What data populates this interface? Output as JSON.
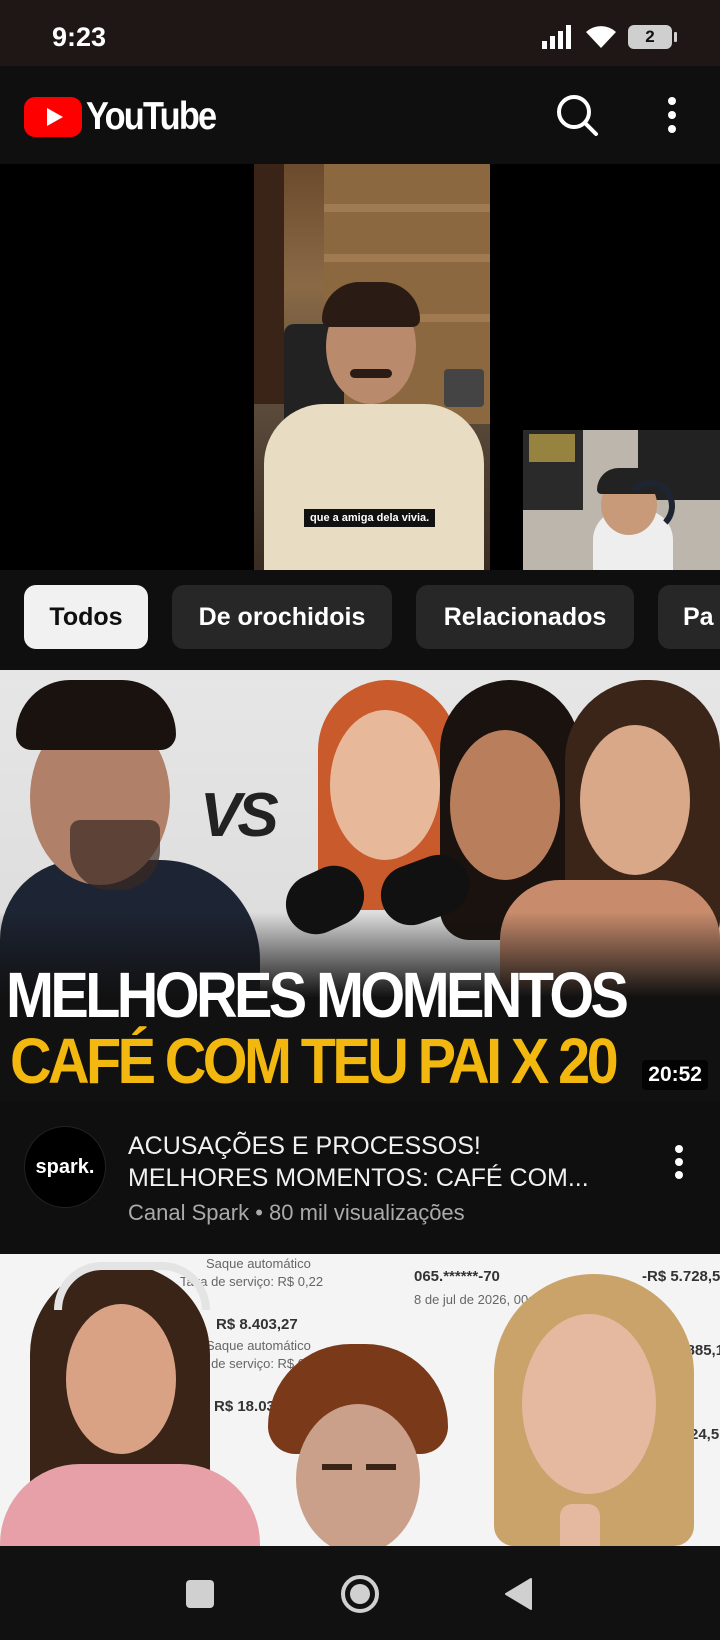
{
  "status": {
    "time": "9:23",
    "battery": "2"
  },
  "app": {
    "logo_text": "YouTube"
  },
  "player": {
    "caption": "que a amiga dela vivia."
  },
  "chips": [
    "Todos",
    "De orochidois",
    "Relacionados",
    "Pa"
  ],
  "video1": {
    "thumb_line1": "MELHORES MOMENTOS",
    "thumb_line2": "CAFÉ COM TEU PAI X 20",
    "thumb_vs": "VS",
    "duration": "20:52",
    "channel_avatar": "spark.",
    "title_line1": "ACUSAÇÕES E PROCESSOS!",
    "title_line2": "MELHORES MOMENTOS: CAFÉ COM...",
    "channel": "Canal Spark",
    "views": "80 mil visualizações"
  },
  "video2": {
    "amounts": [
      "R$ 8.403,27",
      "R$ 18.03",
      "065.******-70",
      "-R$ 5.728,5",
      "4.885,1",
      "24,5"
    ],
    "labels": [
      "Saque automático",
      "Taxa de serviço: R$ 0,22",
      "Saque automático",
      "Taxa de serviço: R$ 0,21",
      "8 de jul de 2026, 00:40"
    ]
  },
  "colors": {
    "brand_red": "#ff0000",
    "thumb_yellow": "#f2b80f",
    "background": "#0f0f0f"
  }
}
